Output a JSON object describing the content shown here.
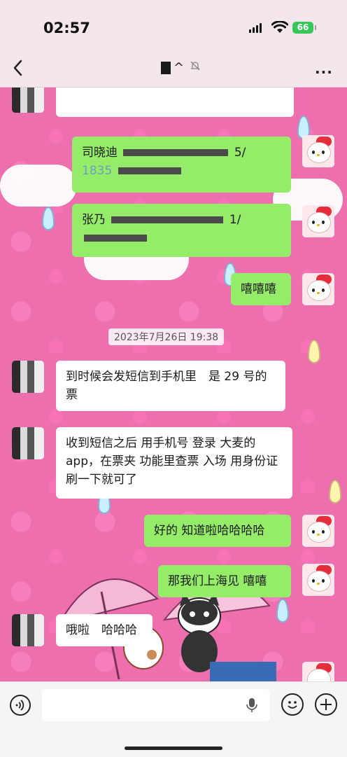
{
  "status_bar": {
    "time": "02:57",
    "battery": "66"
  },
  "nav": {
    "title_fragment": "^",
    "more_label": "..."
  },
  "messages": {
    "m1_out_prefix": "司晓迪",
    "m1_out_tail": "5/",
    "m1_out_line2": "1835",
    "m2_out_prefix": "张乃",
    "m2_out_tail": "1/",
    "m3_out": "嘻嘻嘻",
    "timestamp": "2023年7月26日 19:38",
    "m4_in": "到时候会发短信到手机里　是 29 号的票",
    "m5_in": "收到短信之后 用手机号 登录 大麦的app，在票夹 功能里查票 入场 用身份证刷一下就可了",
    "m6_out": "好的 知道啦哈哈哈哈",
    "m7_out": "那我们上海见 嘻嘻",
    "m8_in": "哦啦　哈哈哈"
  },
  "input": {
    "placeholder": ""
  },
  "colors": {
    "chat_bg": "#ee6fae",
    "bubble_out": "#95ec69",
    "bubble_in": "#ffffff",
    "battery": "#35c759"
  }
}
